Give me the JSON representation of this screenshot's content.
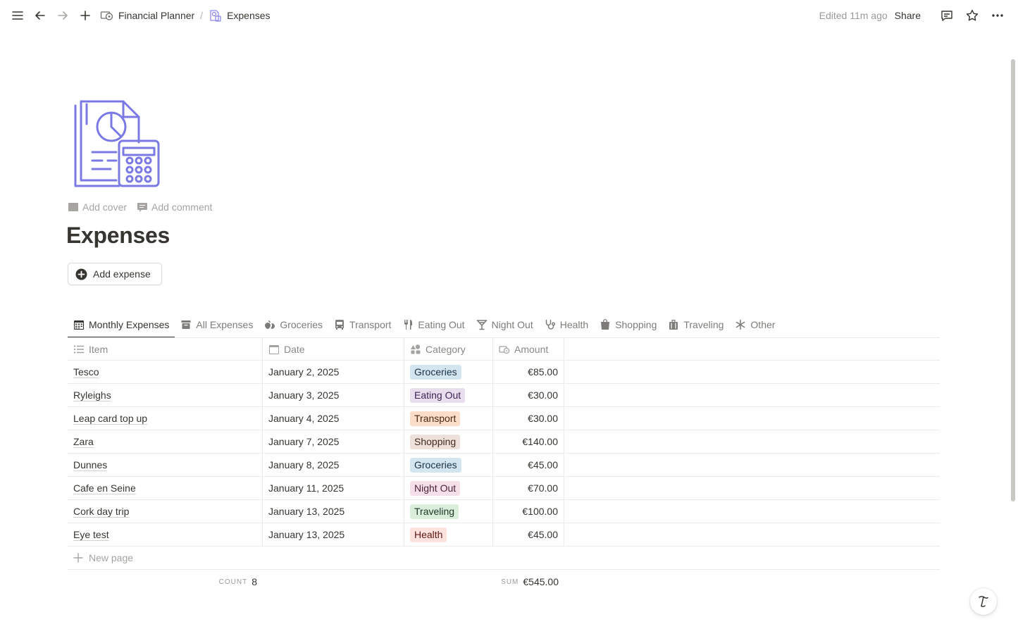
{
  "topbar": {
    "breadcrumb": [
      {
        "label": "Financial Planner",
        "icon": "money-icon"
      },
      {
        "label": "Expenses",
        "icon": "report-icon"
      }
    ],
    "separator": "/",
    "edited": "Edited 11m ago",
    "share_label": "Share"
  },
  "page": {
    "actions": {
      "add_cover": "Add cover",
      "add_comment": "Add comment"
    },
    "title": "Expenses",
    "add_expense_label": "Add expense",
    "icon_color": "#7b79e3"
  },
  "tabs": [
    {
      "label": "Monthly Expenses",
      "icon": "calendar-grid-icon",
      "active": true
    },
    {
      "label": "All Expenses",
      "icon": "archive-icon",
      "active": false
    },
    {
      "label": "Groceries",
      "icon": "produce-icon",
      "active": false
    },
    {
      "label": "Transport",
      "icon": "bus-icon",
      "active": false
    },
    {
      "label": "Eating Out",
      "icon": "fork-knife-icon",
      "active": false
    },
    {
      "label": "Night Out",
      "icon": "cocktail-icon",
      "active": false
    },
    {
      "label": "Health",
      "icon": "stethoscope-icon",
      "active": false
    },
    {
      "label": "Shopping",
      "icon": "bag-icon",
      "active": false
    },
    {
      "label": "Traveling",
      "icon": "suitcase-icon",
      "active": false
    },
    {
      "label": "Other",
      "icon": "asterisk-icon",
      "active": false
    }
  ],
  "table": {
    "columns": {
      "item": "Item",
      "date": "Date",
      "category": "Category",
      "amount": "Amount"
    },
    "rows": [
      {
        "item": "Tesco",
        "date": "January 2, 2025",
        "category": "Groceries",
        "amount": "€85.00"
      },
      {
        "item": "Ryleighs",
        "date": "January 3, 2025",
        "category": "Eating Out",
        "amount": "€30.00"
      },
      {
        "item": "Leap card top up",
        "date": "January 4, 2025",
        "category": "Transport",
        "amount": "€30.00"
      },
      {
        "item": "Zara",
        "date": "January 7, 2025",
        "category": "Shopping",
        "amount": "€140.00"
      },
      {
        "item": "Dunnes",
        "date": "January 8, 2025",
        "category": "Groceries",
        "amount": "€45.00"
      },
      {
        "item": "Cafe en Seine",
        "date": "January 11, 2025",
        "category": "Night Out",
        "amount": "€70.00"
      },
      {
        "item": "Cork day trip",
        "date": "January 13, 2025",
        "category": "Traveling",
        "amount": "€100.00"
      },
      {
        "item": "Eye test",
        "date": "January 13, 2025",
        "category": "Health",
        "amount": "€45.00"
      }
    ],
    "tag_colors": {
      "Groceries": {
        "bg": "#d3e5ef",
        "fg": "#183347"
      },
      "Eating Out": {
        "bg": "#e8deee",
        "fg": "#412454"
      },
      "Transport": {
        "bg": "#fadec9",
        "fg": "#49290e"
      },
      "Shopping": {
        "bg": "#eee0da",
        "fg": "#442a1e"
      },
      "Night Out": {
        "bg": "#f5e0e9",
        "fg": "#4c2337"
      },
      "Traveling": {
        "bg": "#dbeddb",
        "fg": "#1c3829"
      },
      "Health": {
        "bg": "#ffe2dd",
        "fg": "#5d1715"
      }
    },
    "new_page_label": "New page",
    "footer": {
      "count_label": "COUNT",
      "count_value": "8",
      "sum_label": "SUM",
      "sum_value": "€545.00"
    }
  }
}
